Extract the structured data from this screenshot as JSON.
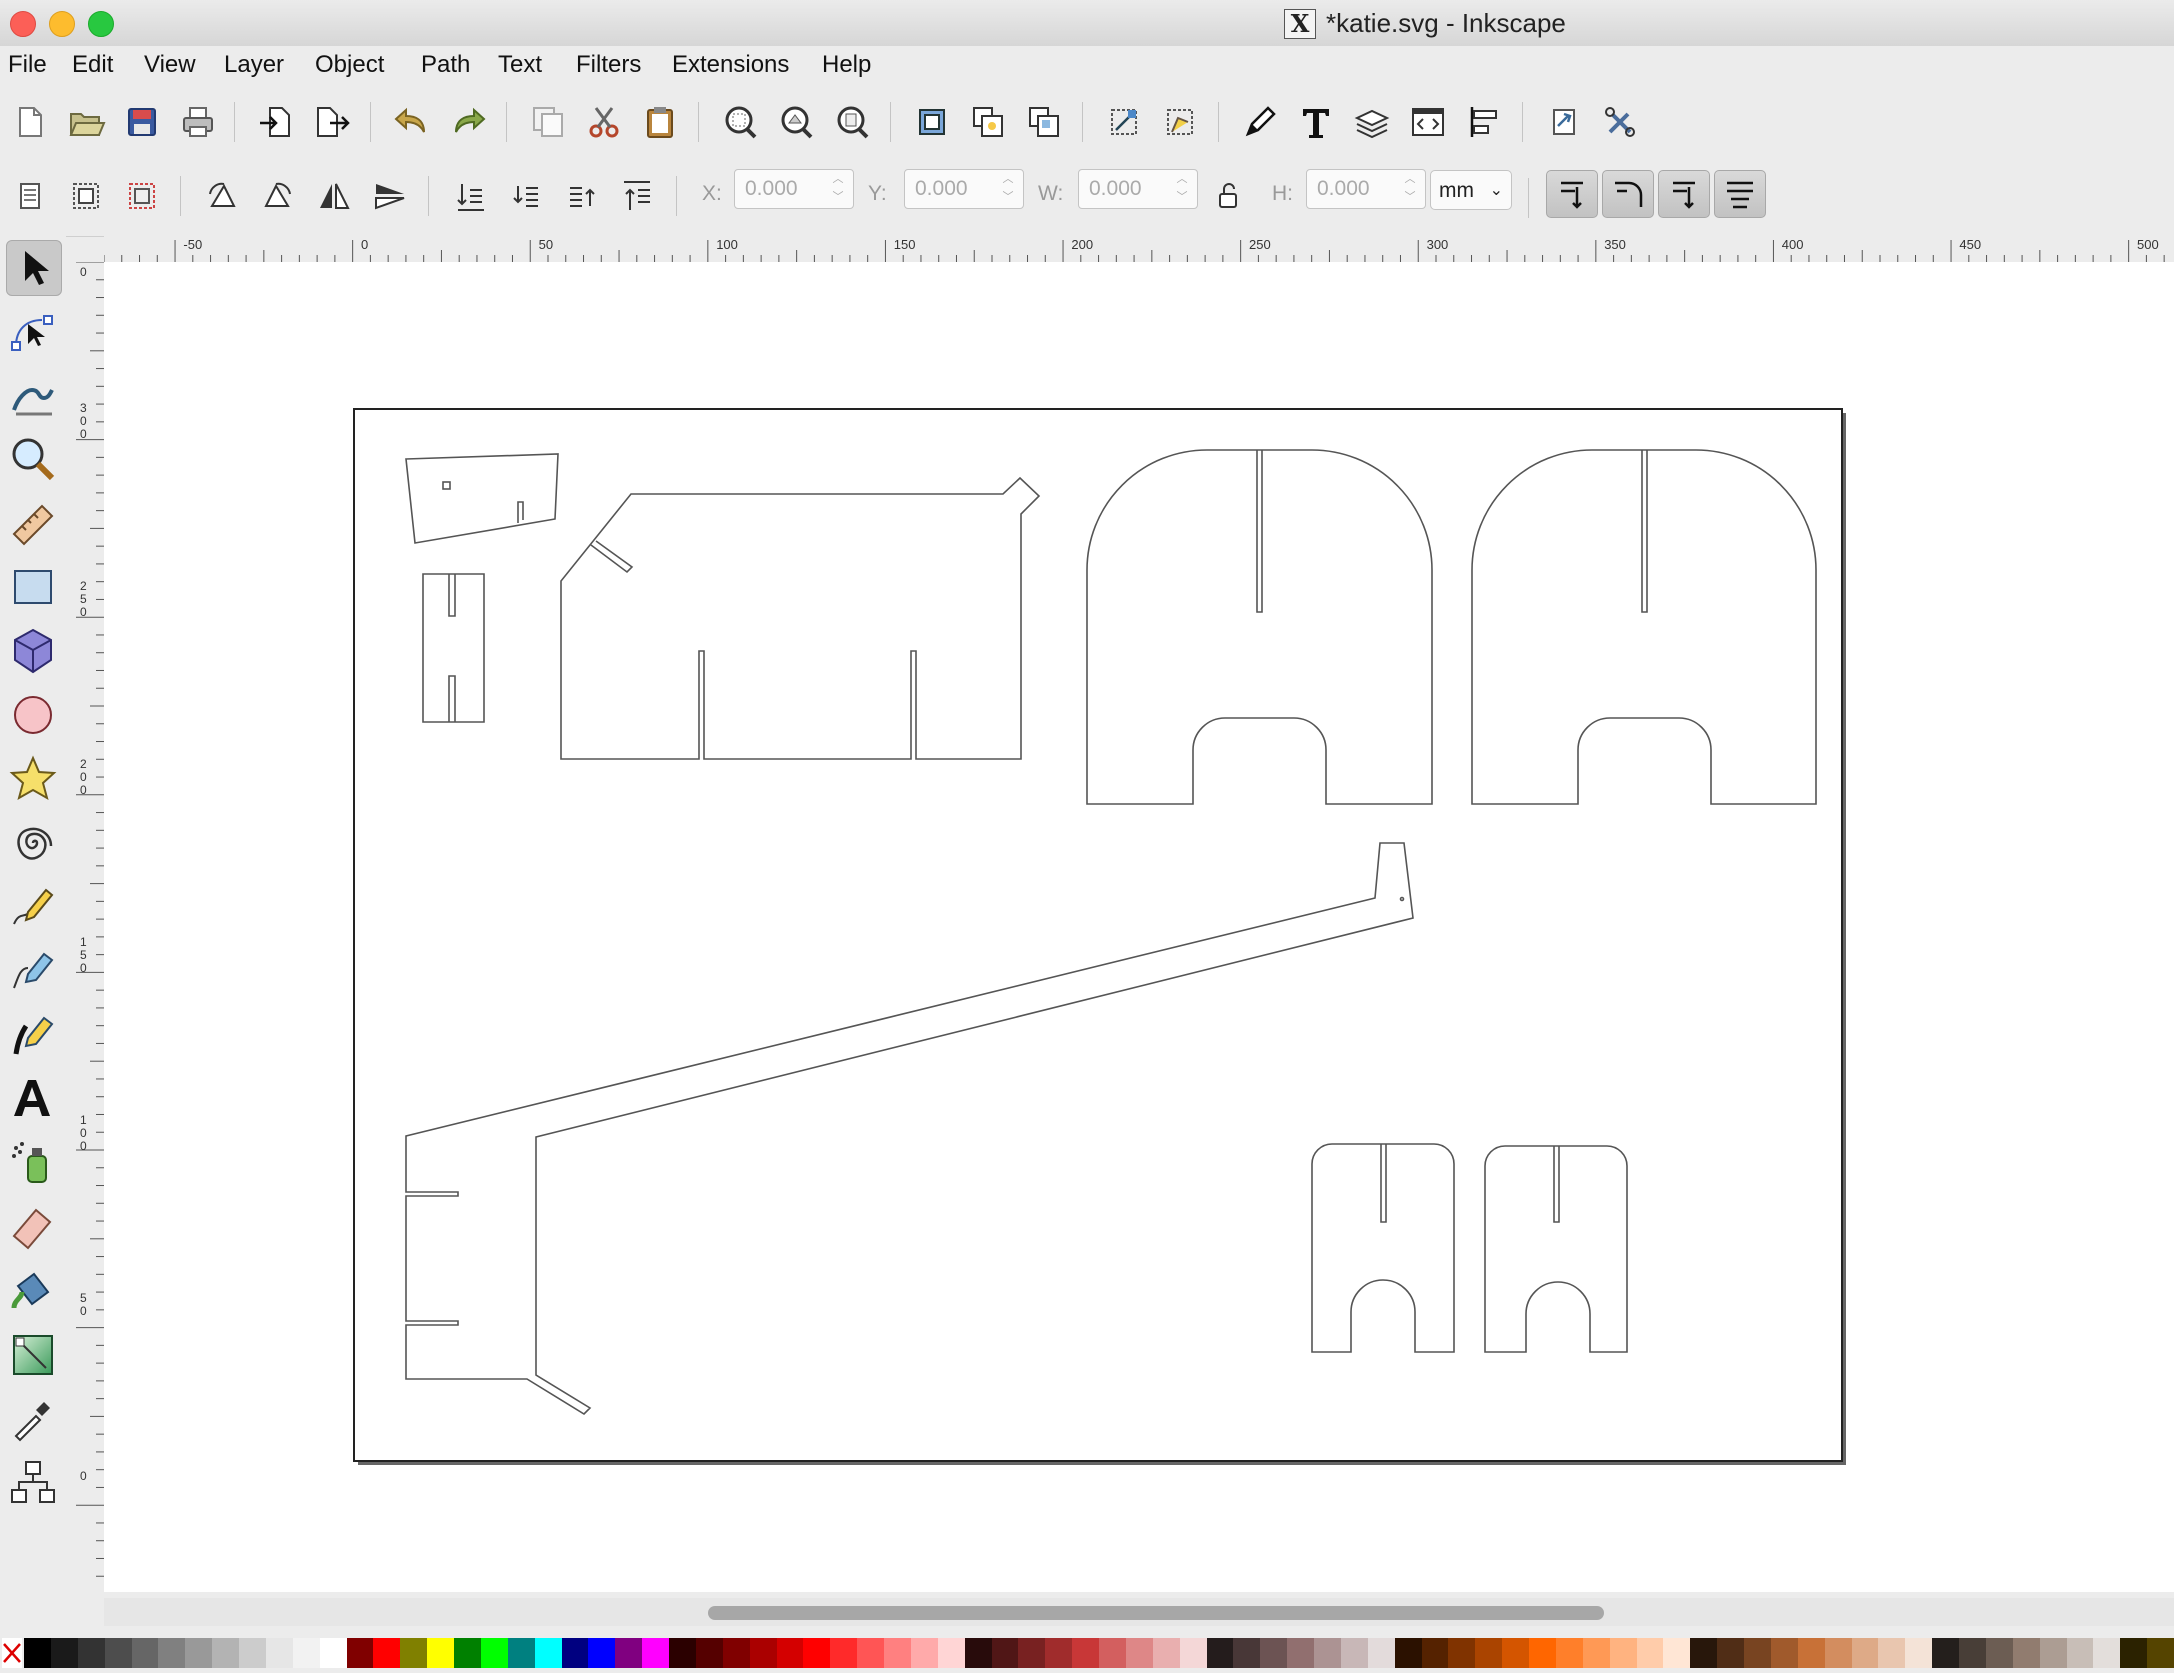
{
  "window": {
    "title": "*katie.svg - Inkscape"
  },
  "menubar": {
    "items": [
      "File",
      "Edit",
      "View",
      "Layer",
      "Object",
      "Path",
      "Text",
      "Filters",
      "Extensions",
      "Help"
    ]
  },
  "toolbar_commands": {
    "icons": [
      "new-document-icon",
      "open-file-icon",
      "save-icon",
      "print-icon",
      "import-icon",
      "export-icon",
      "undo-icon",
      "redo-icon",
      "duplicate-icon",
      "cut-icon",
      "paste-icon",
      "zoom-selection-icon",
      "zoom-drawing-icon",
      "zoom-page-icon",
      "group-icon",
      "ungroup-icon",
      "clone-icon",
      "transform-icon",
      "align-nodes-icon",
      "xml-editor-icon",
      "text-font-icon",
      "layers-icon",
      "object-properties-icon",
      "align-distribute-icon",
      "preferences-icon",
      "document-properties-icon"
    ]
  },
  "tool_controls": {
    "x_label": "X:",
    "x_value": "0.000",
    "y_label": "Y:",
    "y_value": "0.000",
    "w_label": "W:",
    "w_value": "0.000",
    "h_label": "H:",
    "h_value": "0.000",
    "unit": "mm"
  },
  "ruler": {
    "horizontal_ticks": [
      "-50",
      "0",
      "50",
      "100",
      "150",
      "200",
      "250",
      "300",
      "350",
      "400",
      "450",
      "500"
    ],
    "vertical_ticks": [
      "0",
      "3 0 0",
      "2 5 0",
      "2 0 0",
      "1 5 0",
      "1 0 0",
      "5 0",
      "0"
    ]
  },
  "toolbox": {
    "tools": [
      "selector-tool-icon",
      "node-tool-icon",
      "tweak-tool-icon",
      "zoom-tool-icon",
      "measure-tool-icon",
      "rectangle-tool-icon",
      "3d-box-tool-icon",
      "ellipse-tool-icon",
      "star-tool-icon",
      "spiral-tool-icon",
      "pencil-tool-icon",
      "pen-tool-icon",
      "calligraphy-tool-icon",
      "text-tool-icon",
      "spray-tool-icon",
      "eraser-tool-icon",
      "paint-bucket-tool-icon",
      "gradient-tool-icon",
      "dropper-tool-icon",
      "connector-tool-icon"
    ],
    "active": "selector-tool-icon"
  },
  "colors": {
    "palette": [
      "#000000",
      "#1a1a1a",
      "#333333",
      "#4d4d4d",
      "#666666",
      "#808080",
      "#999999",
      "#b3b3b3",
      "#cccccc",
      "#e6e6e6",
      "#f2f2f2",
      "#ffffff",
      "#800000",
      "#ff0000",
      "#808000",
      "#ffff00",
      "#008000",
      "#00ff00",
      "#008080",
      "#00ffff",
      "#000080",
      "#0000ff",
      "#800080",
      "#ff00ff",
      "#2b0000",
      "#550000",
      "#800000",
      "#aa0000",
      "#d40000",
      "#ff0000",
      "#ff2a2a",
      "#ff5555",
      "#ff8080",
      "#ffaaaa",
      "#ffd5d5",
      "#280b0b",
      "#501616",
      "#782121",
      "#a02c2c",
      "#c83737",
      "#d35f5f",
      "#de8787",
      "#e9afaf",
      "#f4d7d7",
      "#241c1c",
      "#483737",
      "#6c5353",
      "#916f6f",
      "#ac9393",
      "#c8b7b7",
      "#e3dbdb",
      "#2b1100",
      "#552200",
      "#803300",
      "#aa4400",
      "#d45500",
      "#ff6600",
      "#ff7f2a",
      "#ff9955",
      "#ffb380",
      "#ffccaa",
      "#ffe6d5",
      "#28170b",
      "#502d16",
      "#784421",
      "#a05a2c",
      "#c87137",
      "#d38d5f",
      "#deaa87",
      "#e9c6af",
      "#f4e3d7",
      "#241f1c",
      "#483e37",
      "#6c5d53",
      "#917c6f",
      "#ac9d93",
      "#c8beb7",
      "#e3dedb",
      "#2b2200",
      "#554400"
    ]
  }
}
